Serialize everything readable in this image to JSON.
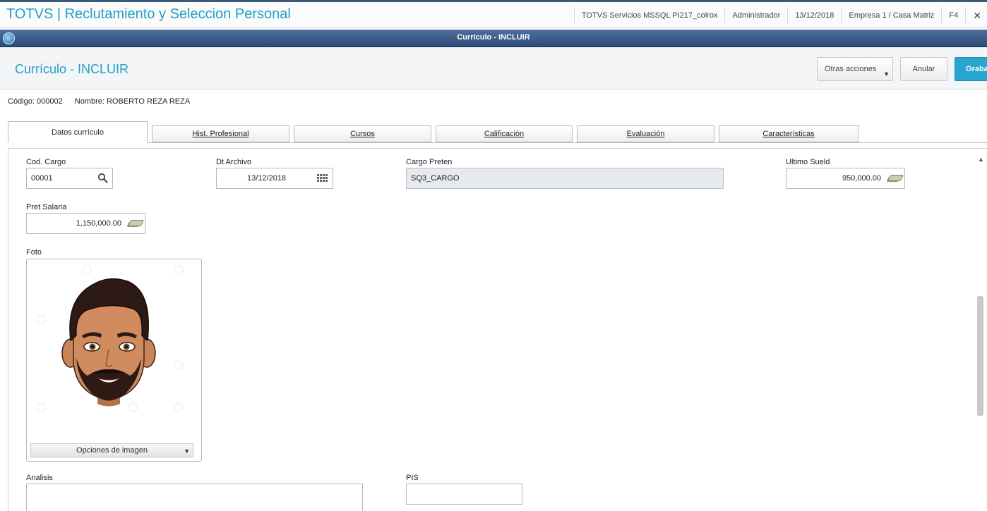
{
  "app": {
    "title": "TOTVS | Reclutamiento y Seleccion Personal",
    "server": "TOTVS Servicios MSSQL PI217_colrox",
    "user": "Administrador",
    "date": "13/12/2018",
    "company": "Empresa 1 / Casa Matriz",
    "shortcut": "F4",
    "close": "✕"
  },
  "window": {
    "title": "Currículo - INCLUIR"
  },
  "header": {
    "title": "Currículo - INCLUIR",
    "more_actions": "Otras acciones",
    "cancel": "Anular",
    "save": "Grabar"
  },
  "record": {
    "code": "Código: 000002",
    "name": "Nombre: ROBERTO REZA REZA"
  },
  "tabs": [
    {
      "label": "Datos currículo",
      "active": true
    },
    {
      "label": "Hist. Profesional",
      "active": false
    },
    {
      "label": "Cursos",
      "active": false
    },
    {
      "label": "Calificación",
      "active": false
    },
    {
      "label": "Evaluación",
      "active": false
    },
    {
      "label": "Características",
      "active": false
    }
  ],
  "form": {
    "cod_cargo": {
      "label": "Cod. Cargo",
      "value": "00001"
    },
    "dt_archivo": {
      "label": "Dt Archivo",
      "value": "13/12/2018"
    },
    "cargo_preten": {
      "label": "Cargo Preten",
      "value": "SQ3_CARGO"
    },
    "ultimo_sueld": {
      "label": "Ultimo Sueld",
      "value": "950,000.00"
    },
    "pret_salaria": {
      "label": "Pret Salaria",
      "value": "1,150,000.00"
    },
    "foto": {
      "label": "Foto",
      "options": "Opciones de imagen"
    },
    "analisis": {
      "label": "Analisis",
      "value": ""
    },
    "pis": {
      "label": "PIS",
      "value": ""
    }
  },
  "icons": {
    "lookup": "search-icon",
    "calendar": "calendar-icon",
    "currency": "money-icon"
  },
  "colors": {
    "accent": "#1ea0c8",
    "titlebar": "#2c4a79",
    "save_button": "#2aa5cf"
  }
}
